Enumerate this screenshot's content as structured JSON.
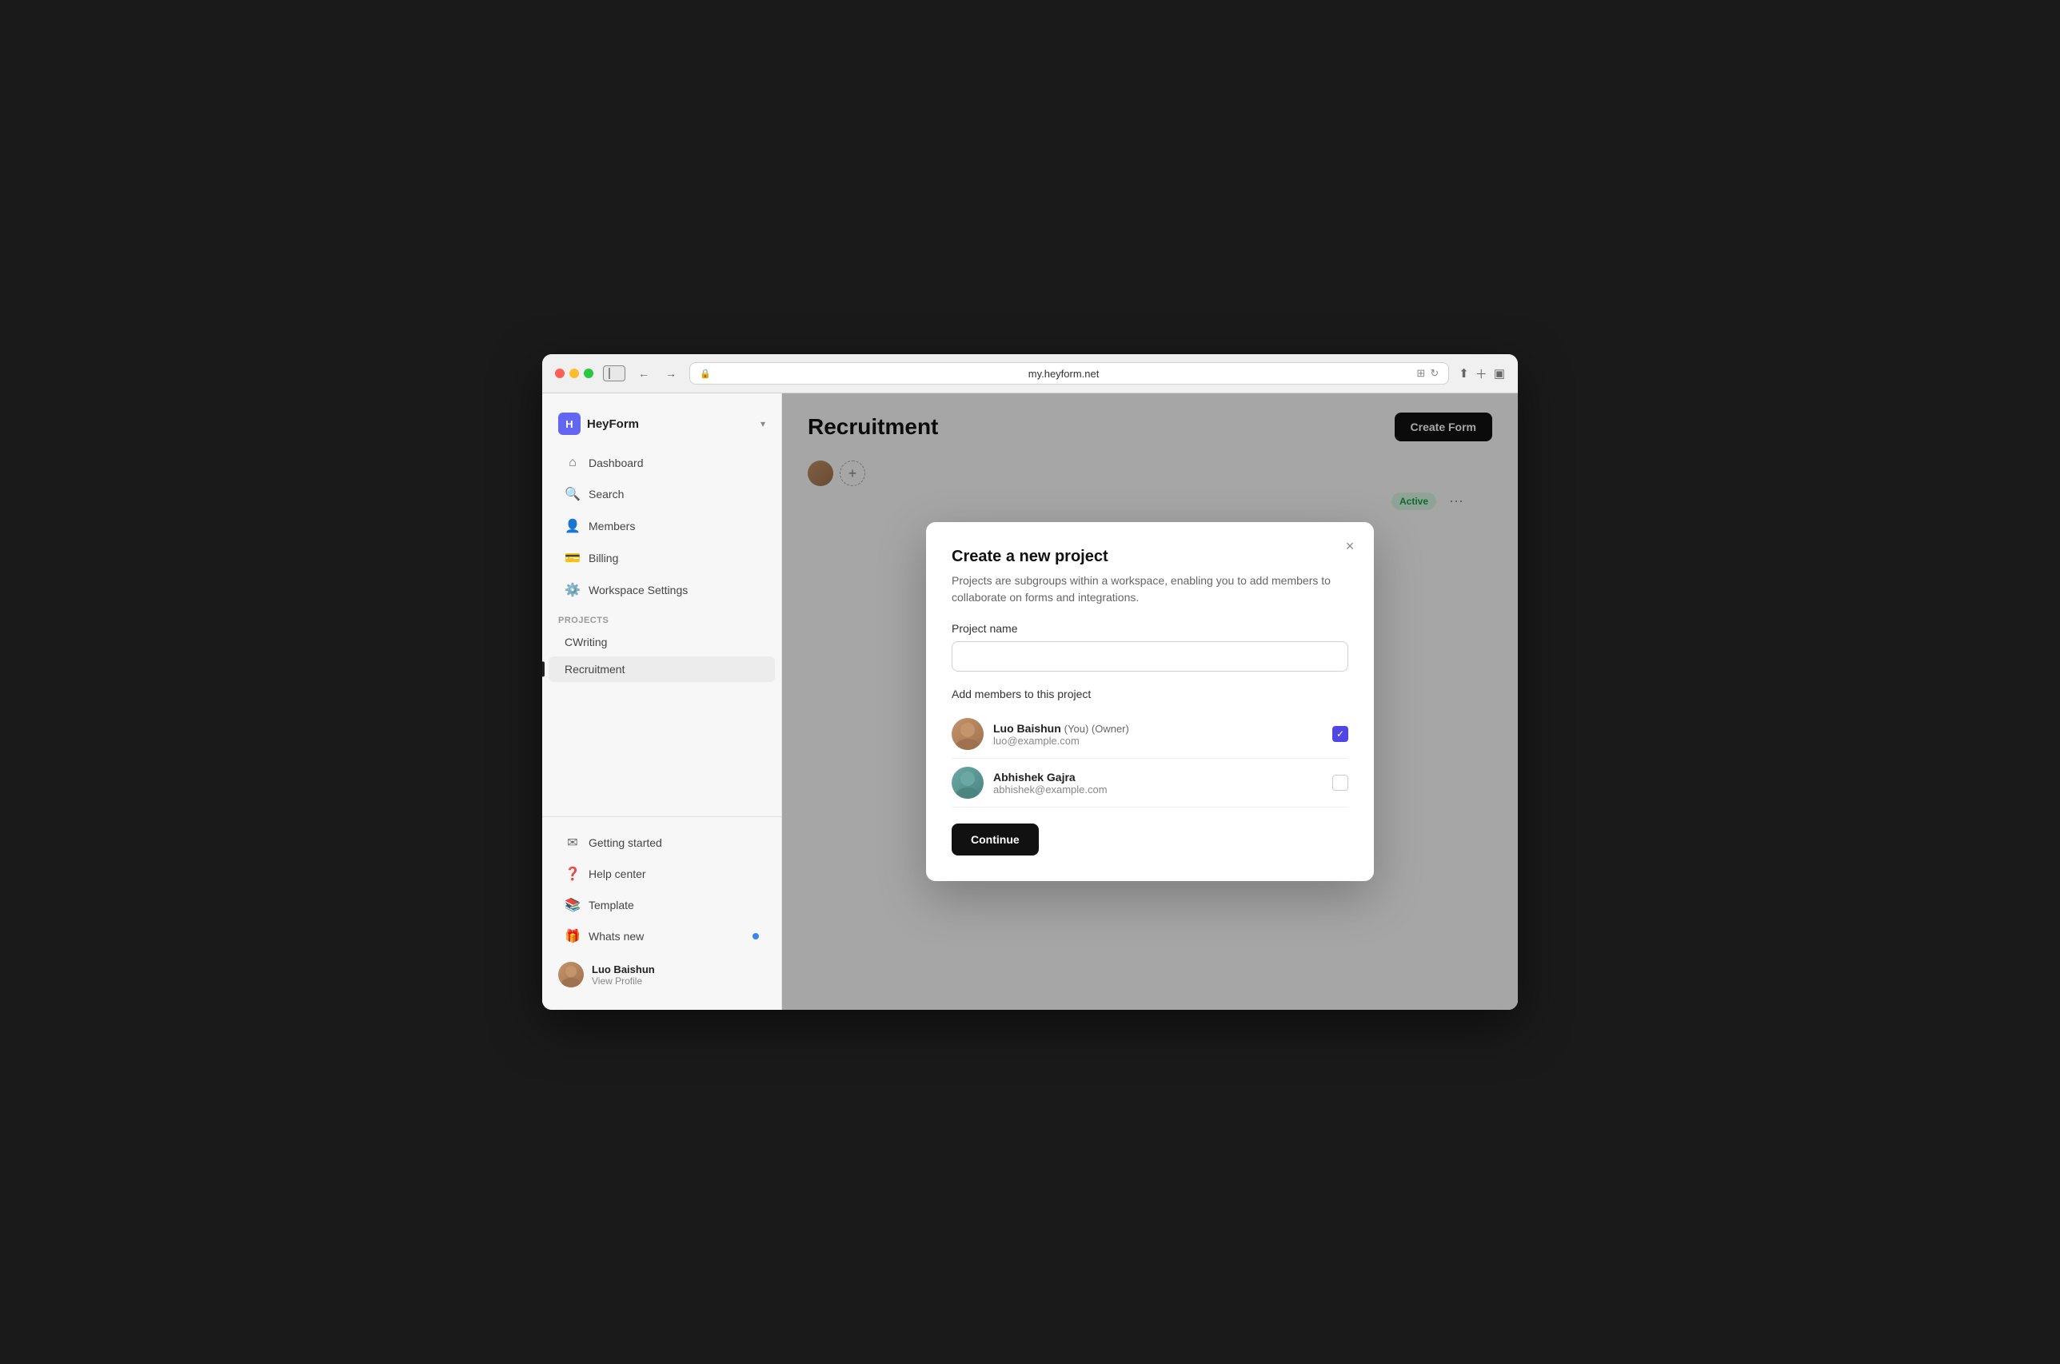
{
  "browser": {
    "url": "my.heyform.net",
    "back_label": "←",
    "forward_label": "→"
  },
  "sidebar": {
    "workspace_name": "HeyForm",
    "workspace_initial": "H",
    "nav_items": [
      {
        "id": "dashboard",
        "label": "Dashboard",
        "icon": "🏠"
      },
      {
        "id": "search",
        "label": "Search",
        "icon": "🔍"
      },
      {
        "id": "members",
        "label": "Members",
        "icon": "👤"
      },
      {
        "id": "billing",
        "label": "Billing",
        "icon": "💳"
      },
      {
        "id": "workspace-settings",
        "label": "Workspace Settings",
        "icon": "⚙️"
      }
    ],
    "projects_label": "Projects",
    "projects": [
      {
        "id": "cwriting",
        "label": "CWriting"
      },
      {
        "id": "recruitment",
        "label": "Recruitment",
        "active": true
      }
    ],
    "bottom_items": [
      {
        "id": "getting-started",
        "label": "Getting started",
        "icon": "✉️"
      },
      {
        "id": "help-center",
        "label": "Help center",
        "icon": "❓"
      },
      {
        "id": "template",
        "label": "Template",
        "icon": "📚"
      },
      {
        "id": "whats-new",
        "label": "Whats new",
        "icon": "🎁",
        "badge": true
      }
    ],
    "user": {
      "name": "Luo Baishun",
      "sub": "View Profile"
    }
  },
  "main": {
    "page_title": "Recruitment",
    "create_form_btn": "Create Form",
    "active_badge": "Active"
  },
  "modal": {
    "title": "Create a new project",
    "description": "Projects are subgroups within a workspace, enabling you to add members to collaborate on forms and integrations.",
    "project_name_label": "Project name",
    "project_name_placeholder": "",
    "add_members_label": "Add members to this project",
    "members": [
      {
        "id": "luo-baishun",
        "name": "Luo Baishun",
        "tags": "(You) (Owner)",
        "email": "luo@example.com",
        "checked": true
      },
      {
        "id": "abhishek-gajra",
        "name": "Abhishek Gajra",
        "tags": "",
        "email": "abhishek@example.com",
        "checked": false
      }
    ],
    "continue_btn": "Continue",
    "close_label": "×"
  }
}
